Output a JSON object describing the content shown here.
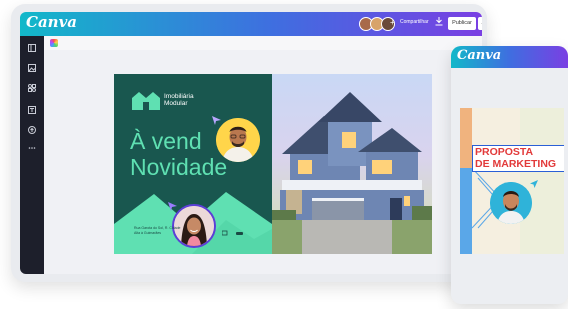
{
  "app": {
    "logo": "Canva"
  },
  "topbar": {
    "share_label": "Compartilhar",
    "download_icon": "download-icon",
    "publish_label": "Publicar",
    "more_label": "..."
  },
  "sidebar": {
    "items": [
      "template-icon",
      "photo-icon",
      "elements-icon",
      "text-icon",
      "upload-icon",
      "more-icon"
    ]
  },
  "design": {
    "brand_line1": "Imobiliária",
    "brand_line2": "Modular",
    "headline_line1": "À vend",
    "headline_line2": "Novidade",
    "footer_text": "Rua Garota do Sol, R. Cidade Alta à Guimarães",
    "accent": "#5fe0b2",
    "background": "#19574f"
  },
  "phone": {
    "logo": "Canva",
    "title_line1": "PROPOSTA",
    "title_line2": "DE MARKETING",
    "title_color": "#e23a3a",
    "frame_color": "#2a5fd6"
  }
}
